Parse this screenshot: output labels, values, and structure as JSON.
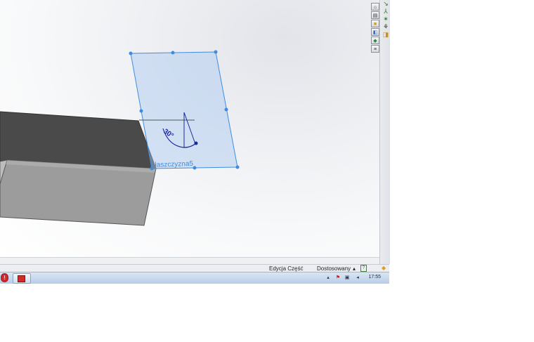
{
  "viewport": {
    "plane_label": "Płaszczyzna5",
    "angle_label": "30°"
  },
  "task_pane": {
    "tabs": [
      "home-icon",
      "resources-icon",
      "folder-icon",
      "appearance-icon",
      "palette-icon",
      "properties-icon"
    ]
  },
  "status_bar": {
    "mode": "Edycja Część",
    "units": "Dostosowany",
    "units_arrow": "▴",
    "help_icon": "?"
  },
  "taskbar": {
    "clock": "17:55",
    "tray_arrow": "▴"
  }
}
